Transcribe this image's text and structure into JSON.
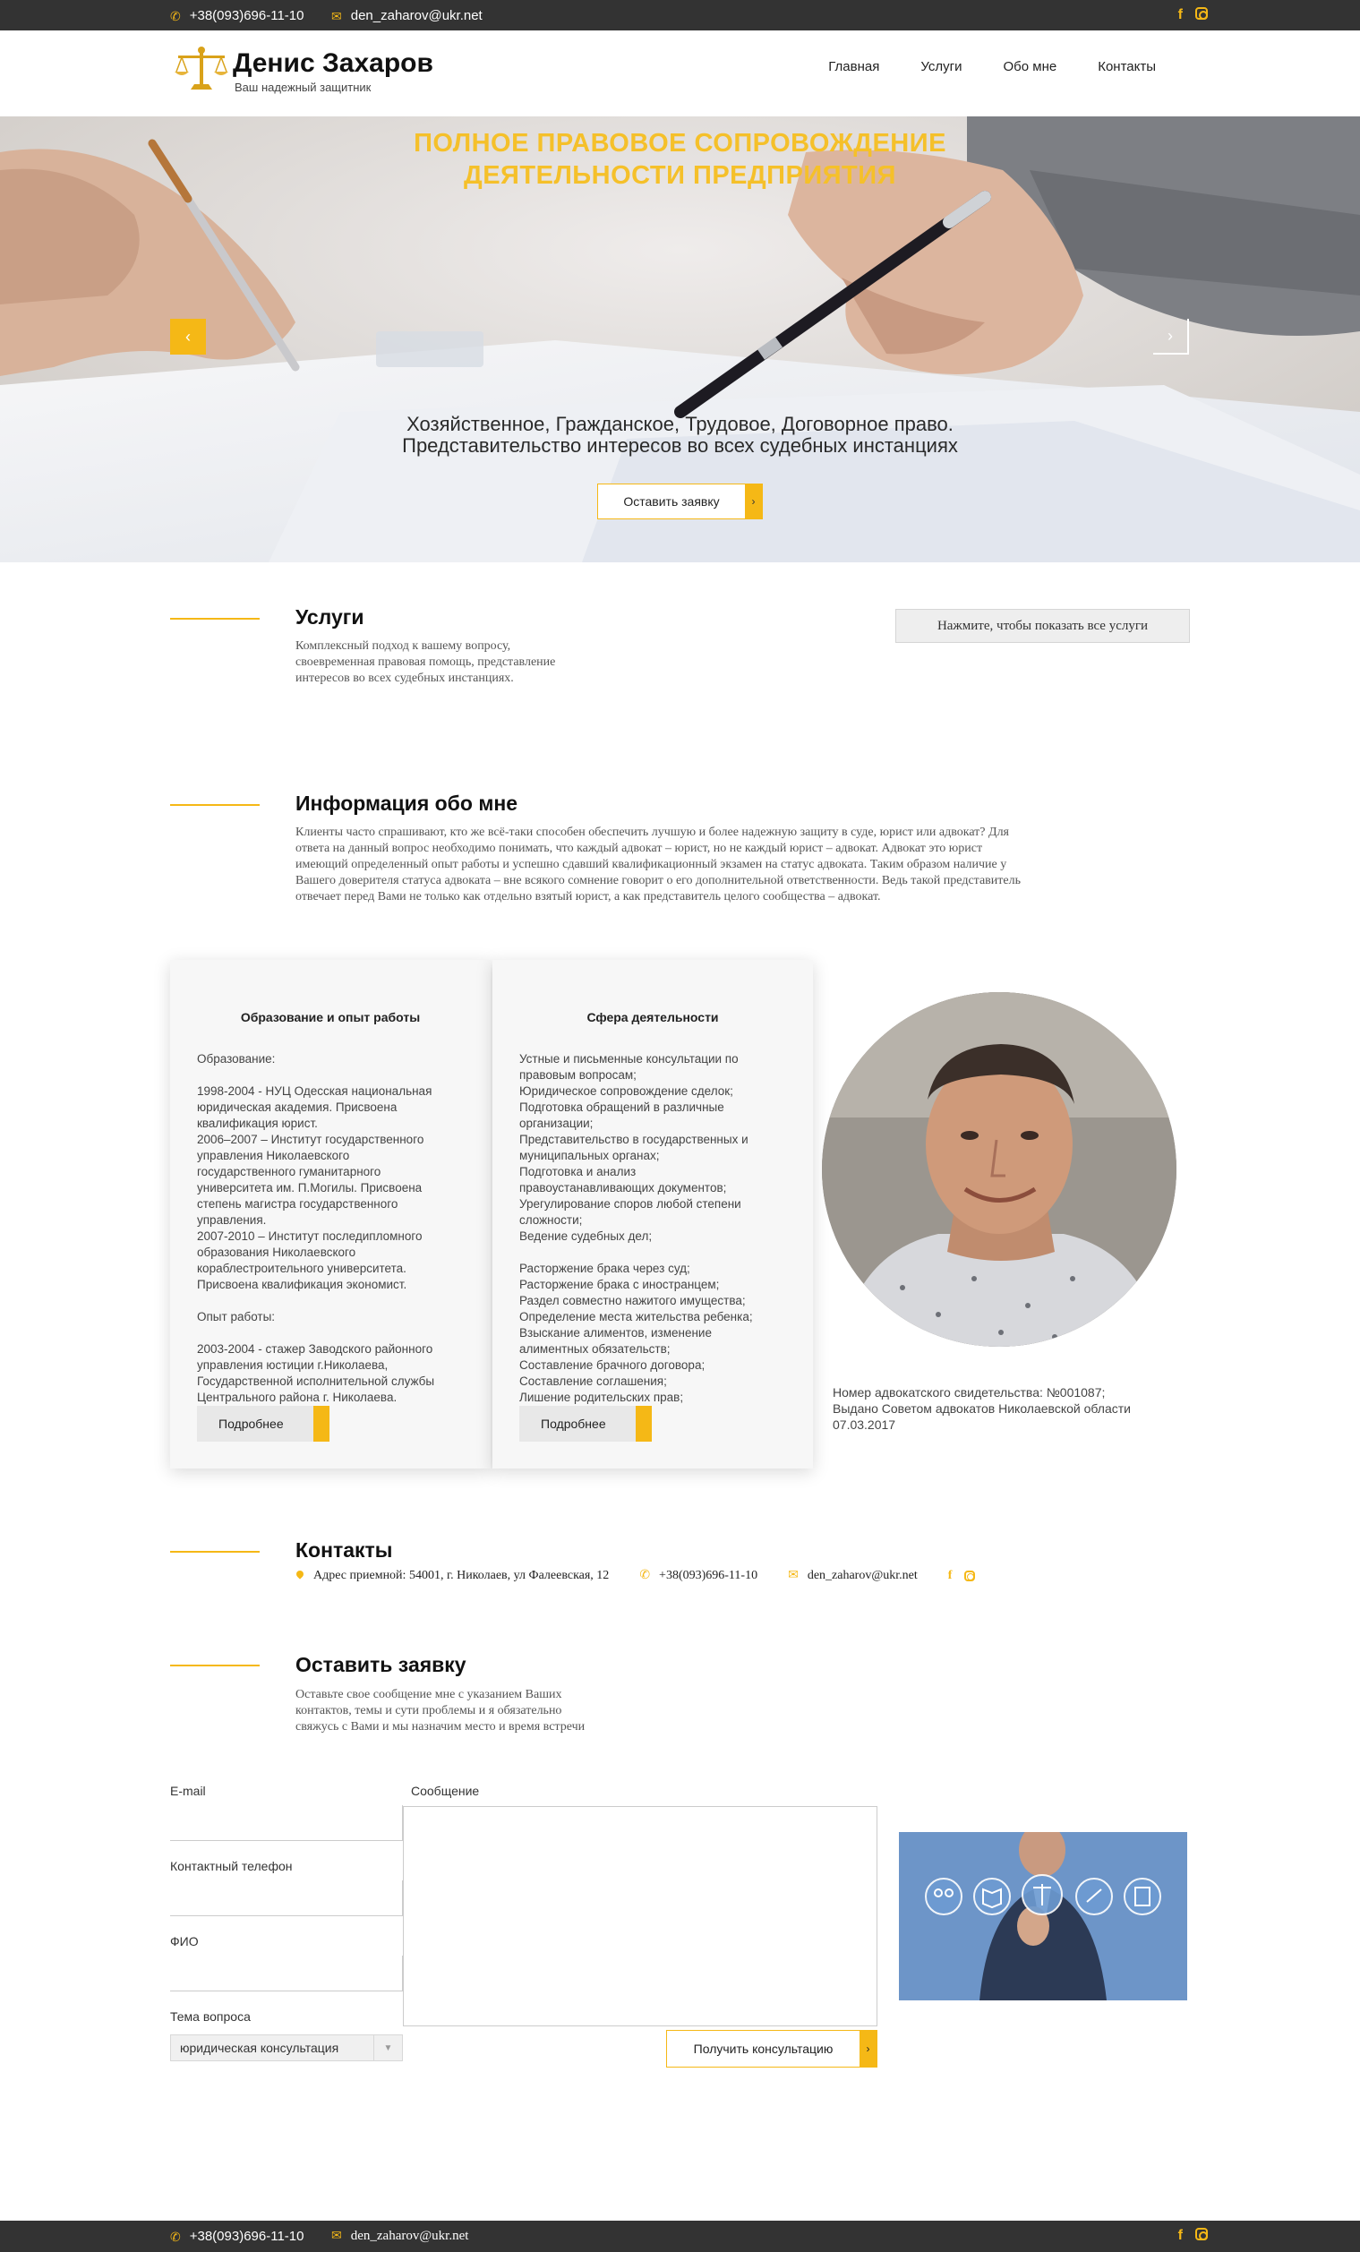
{
  "topbar": {
    "phone": "+38(093)696-11-10",
    "email": "den_zaharov@ukr.net"
  },
  "header": {
    "brand_name": "Денис Захаров",
    "brand_tagline": "Ваш надежный защитник",
    "nav": [
      "Главная",
      "Услуги",
      "Обо мне",
      "Контакты"
    ]
  },
  "hero": {
    "title_line1": "ПОЛНОЕ ПРАВОВОЕ СОПРОВОЖДЕНИЕ",
    "title_line2": "ДЕЯТЕЛЬНОСТИ ПРЕДПРИЯТИЯ",
    "subtitle_line1": "Хозяйственное, Гражданское, Трудовое, Договорное право.",
    "subtitle_line2": "Представительство интересов во всех судебных инстанциях",
    "button": "Оставить заявку",
    "prev_icon": "‹",
    "next_icon": "›"
  },
  "services": {
    "title": "Услуги",
    "text_line1": "Комплексный подход к вашему вопросу,",
    "text_line2": "своевременная правовая помощь, представление",
    "text_line3": "интересов во всех судебных инстанциях.",
    "show_all_button": "Нажмите, чтобы показать все услуги"
  },
  "about": {
    "title": "Информация обо мне",
    "text_line1": "Клиенты часто спрашивают, кто же всё-таки способен обеспечить лучшую и более надежную защиту в суде, юрист или адвокат? Для",
    "text_line2": "ответа на данный вопрос необходимо понимать, что каждый адвокат – юрист, но не каждый юрист – адвокат. Адвокат это юрист",
    "text_line3": "имеющий определенный опыт работы и успешно сдавший квалификационный экзамен на статус адвоката. Таким образом наличие у",
    "text_line4": "Вашего доверителя статуса адвоката – вне всякого сомнение говорит о его дополнительной ответственности. Ведь такой представитель",
    "text_line5": "отвечает перед Вами не только как отдельно взятый юрист, а как представитель целого сообщества – адвокат."
  },
  "cards": [
    {
      "title": "Образование и опыт работы",
      "body": "Образование:\n\n1998-2004 - НУЦ Одесская национальная\nюридическая академия. Присвоена\nквалификация юрист.\n2006–2007 – Институт государственного\nуправления Николаевского\nгосударственного гуманитарного\nуниверситета им. П.Могилы. Присвоена\nстепень магистра государственного\nуправления.\n2007-2010 – Институт последипломного\nобразования Николаевского\nкораблестроительного университета.\nПрисвоена квалификация экономист.\n\nОпыт работы:\n\n2003-2004 - стажер Заводского районного\nуправления юстиции г.Николаева,\nГосударственной исполнительной службы\nЦентрального района г. Николаева.",
      "button": "Подробнее"
    },
    {
      "title": "Сфера деятельности",
      "body": "Устные и письменные консультации по\nправовым вопросам;\nЮридическое сопровождение сделок;\nПодготовка обращений в различные\nорганизации;\nПредставительство в государственных и\nмуниципальных органах;\nПодготовка и анализ\nправоустанавливающих документов;\nУрегулирование споров любой степени\nсложности;\nВедение судебных дел;\n\nРасторжение брака через суд;\nРасторжение брака с иностранцем;\nРаздел совместно нажитого имущества;\nОпределение места жительства ребенка;\nВзыскание алиментов, изменение\nалиментных обязательств;\nСоставление брачного договора;\nСоставление соглашения;\nЛишение родительских прав;",
      "button": "Подробнее"
    }
  ],
  "certificate": "Номер адвокатского свидетельства: №001087;\nВыдано Советом адвокатов Николаевской области\n07.03.2017",
  "contacts": {
    "title": "Контакты",
    "address": "Адрес приемной: 54001, г. Николаев, ул Фалеевская, 12",
    "phone": "+38(093)696-11-10",
    "email": "den_zaharov@ukr.net"
  },
  "request": {
    "title": "Оставить заявку",
    "text_line1": "Оставьте свое сообщение мне с указанием Ваших",
    "text_line2": "контактов, темы и сути проблемы и я обязательно",
    "text_line3": "свяжусь с Вами и мы назначим место и время встречи",
    "email_label": "E-mail",
    "phone_label": "Контактный телефон",
    "name_label": "ФИО",
    "topic_label": "Тема вопроса",
    "topic_value": "юридическая консультация",
    "message_label": "Сообщение",
    "submit": "Получить консультацию"
  },
  "bottombar": {
    "phone": "+38(093)696-11-10",
    "email": "den_zaharov@ukr.net"
  },
  "colors": {
    "accent": "#f5b816",
    "dark_bar": "#333333"
  }
}
